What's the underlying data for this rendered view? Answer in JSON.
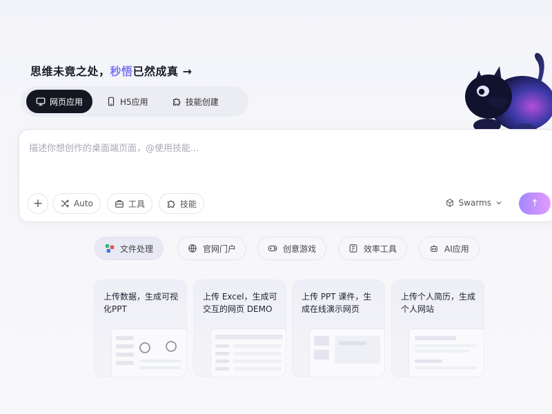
{
  "headline": {
    "part1": "思维未竟之处，",
    "highlight": "秒悟",
    "part2": "已然成真 →"
  },
  "modes": [
    {
      "label": "网页应用",
      "icon": "monitor-icon",
      "active": true
    },
    {
      "label": "H5应用",
      "icon": "phone-icon",
      "active": false
    },
    {
      "label": "技能创建",
      "icon": "puzzle-icon",
      "active": false
    }
  ],
  "composer": {
    "placeholder": "描述你想创作的桌面端页面，@使用技能...",
    "plus": "+",
    "auto_label": "Auto",
    "tools_label": "工具",
    "skills_label": "技能",
    "swarms_label": "Swarms",
    "send_symbol": "↑"
  },
  "categories": [
    {
      "label": "文件处理",
      "icon": "files-icon",
      "active": true
    },
    {
      "label": "官网门户",
      "icon": "globe-icon",
      "active": false
    },
    {
      "label": "创意游戏",
      "icon": "gamepad-icon",
      "active": false
    },
    {
      "label": "效率工具",
      "icon": "tool-icon",
      "active": false
    },
    {
      "label": "AI应用",
      "icon": "robot-icon",
      "active": false
    }
  ],
  "cards": [
    {
      "text": "上传数据，生成可视化PPT"
    },
    {
      "text": "上传 Excel，生成可交互的网页 DEMO"
    },
    {
      "text": "上传 PPT 课件，生成在线演示网页"
    },
    {
      "text": "上传个人简历，生成个人网站"
    }
  ],
  "colors": {
    "accent": "#7d76f2",
    "dark": "#141721",
    "send_from": "#a287ff",
    "send_to": "#e49bff"
  }
}
